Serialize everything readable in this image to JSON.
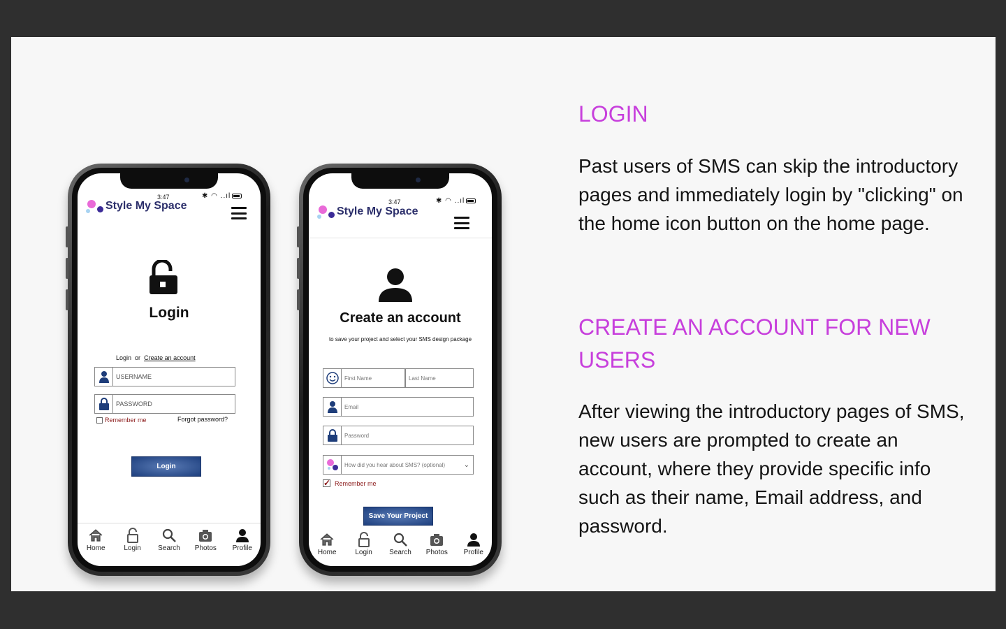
{
  "left_phone": {
    "time": "3:47",
    "brand": "Style My Space",
    "title": "Login",
    "login_label": "Login",
    "or_label": "or",
    "create_link": "Create an account",
    "username_placeholder": "USERNAME",
    "password_placeholder": "PASSWORD",
    "remember_label": "Remember me",
    "forgot_label": "Forgot password?",
    "login_button": "Login",
    "tabs": [
      "Home",
      "Login",
      "Search",
      "Photos",
      "Profile"
    ]
  },
  "right_phone": {
    "time": "3:47",
    "brand": "Style My Space",
    "title": "Create an account",
    "subtitle": "to save your project and select your SMS design package",
    "first_name_placeholder": "First Name",
    "last_name_placeholder": "Last Name",
    "email_placeholder": "Email",
    "password_placeholder": "Password",
    "hear_placeholder": "How did you hear about SMS? (optional)",
    "remember_label": "Remember me",
    "save_button": "Save Your Project",
    "tabs": [
      "Home",
      "Login",
      "Search",
      "Photos",
      "Profile"
    ]
  },
  "right_text": {
    "login_heading": "LOGIN",
    "login_body": "Past users of SMS can skip the introductory pages and immediately login by \"clicking\" on the home icon button on the home page.",
    "create_heading": "CREATE AN ACCOUNT FOR NEW USERS",
    "create_body": "After viewing the introductory pages of SMS, new users are prompted to create an account, where they provide specific info such as their name, Email address, and password."
  },
  "colors": {
    "heading": "#c73fdc",
    "brand_text": "#2c2f6b",
    "button": "#1d3f7e",
    "remember_text": "#8b1a1a"
  }
}
